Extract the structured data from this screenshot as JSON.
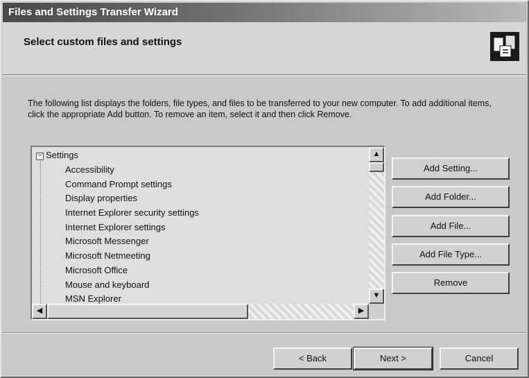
{
  "window": {
    "title": "Files and Settings Transfer Wizard"
  },
  "header": {
    "title": "Select custom files and settings",
    "icon": "wizard-transfer-icon"
  },
  "description": "The following list displays the folders, file types, and files to be transferred to your new computer. To add additional items, click the appropriate Add button. To remove an item, select it and then click Remove.",
  "tree": {
    "root_label": "Settings",
    "root_expander": "−",
    "items": [
      "Accessibility",
      "Command Prompt settings",
      "Display properties",
      "Internet Explorer security settings",
      "Internet Explorer settings",
      "Microsoft Messenger",
      "Microsoft Netmeeting",
      "Microsoft Office",
      "Mouse and keyboard",
      "MSN Explorer"
    ]
  },
  "scrollbar": {
    "up": "▲",
    "down": "▼",
    "left": "◀",
    "right": "▶"
  },
  "actions": {
    "add_setting": "Add Setting...",
    "add_folder": "Add Folder...",
    "add_file": "Add File...",
    "add_file_type": "Add File Type...",
    "remove": "Remove"
  },
  "nav": {
    "back": "< Back",
    "next": "Next >",
    "cancel": "Cancel"
  }
}
